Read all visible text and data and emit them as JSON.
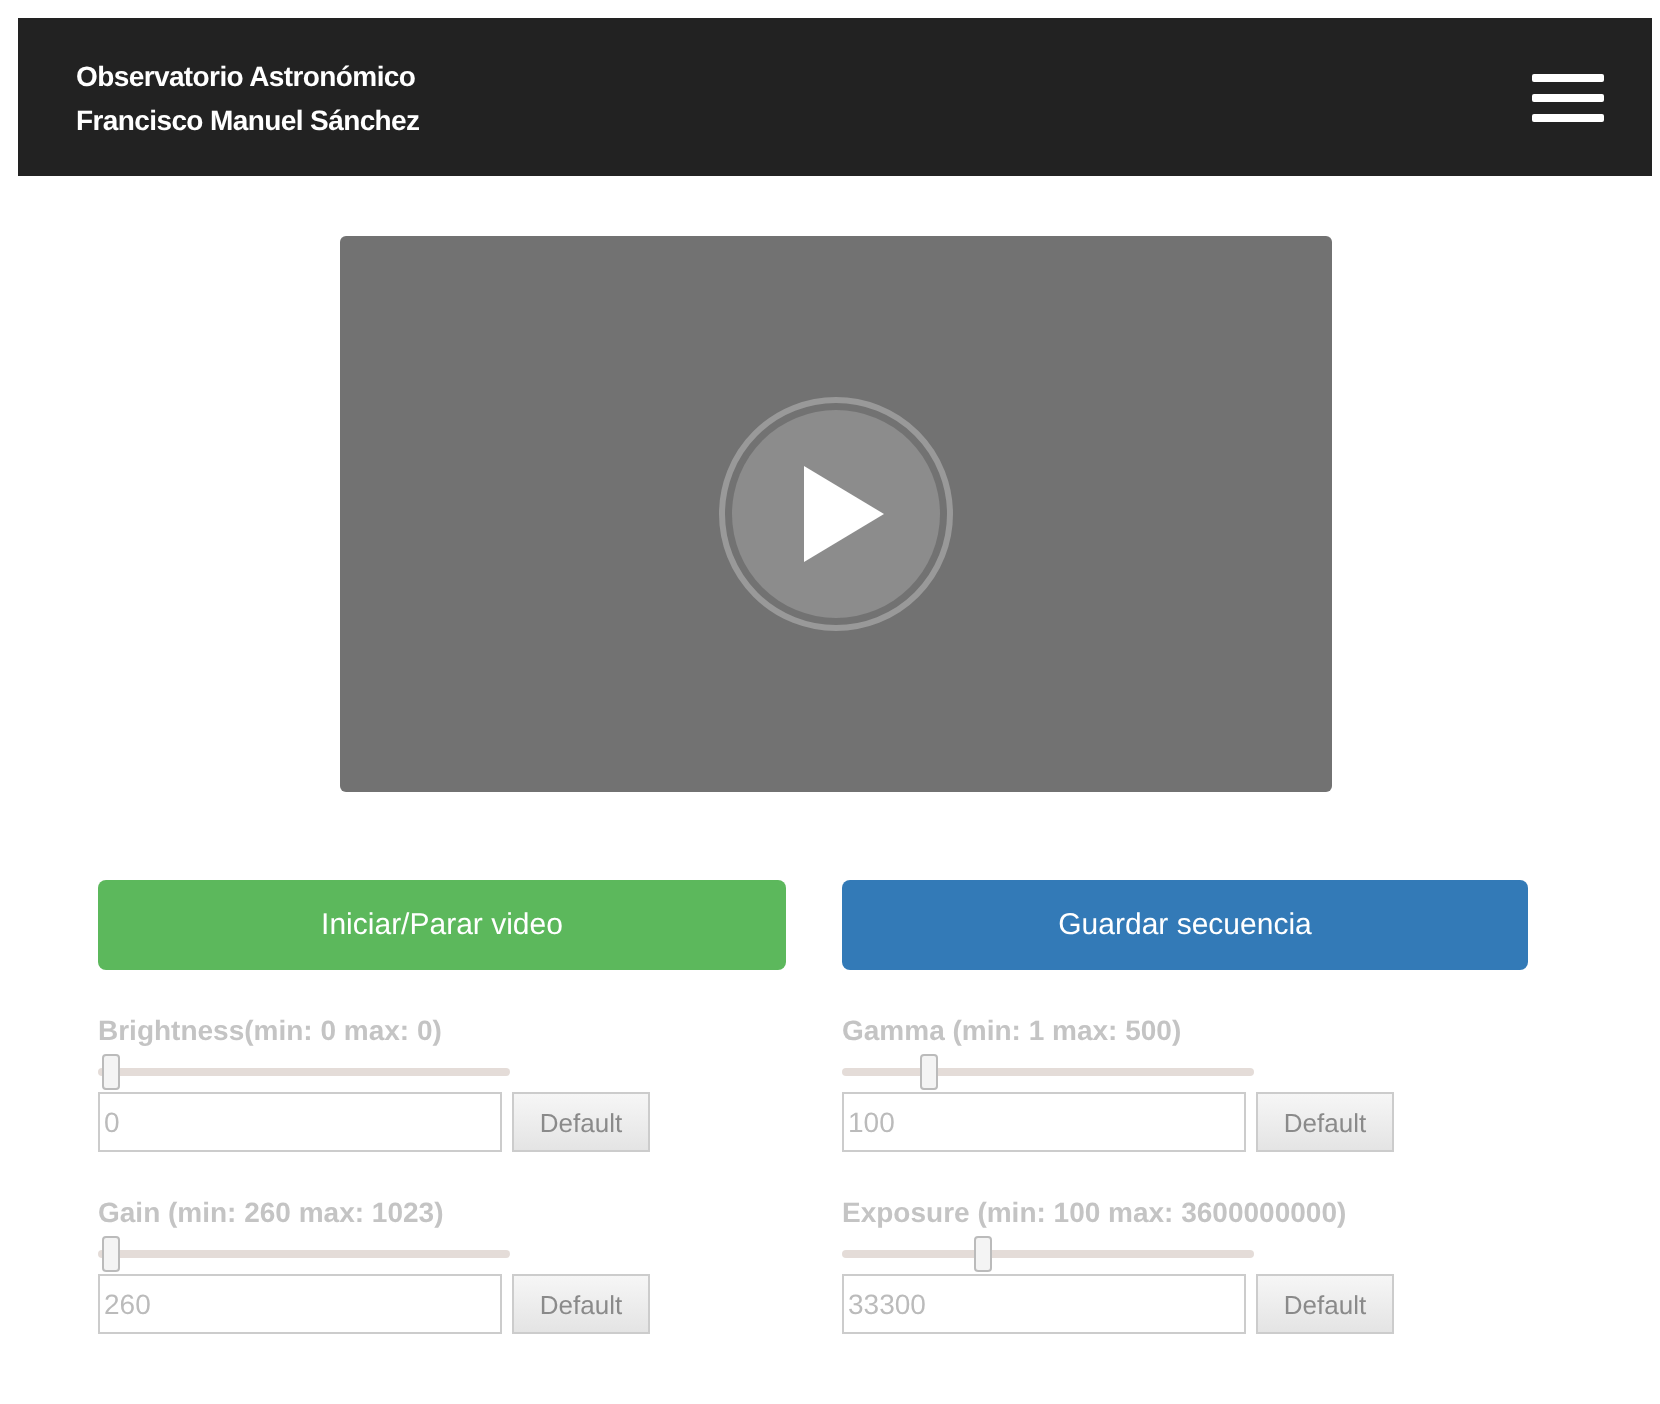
{
  "header": {
    "title_lines": [
      "Observatorio Astronómico",
      "Francisco Manuel Sánchez"
    ]
  },
  "actions": [
    {
      "label": "Iniciar/Parar video",
      "color": "#5cb85c"
    },
    {
      "label": "Guardar secuencia",
      "color": "#337ab7"
    }
  ],
  "controls": [
    {
      "label": "Brightness(min: 0 max: 0)",
      "level": 0.03,
      "value": "0",
      "button": "Default",
      "disabled": true
    },
    {
      "label": "Gamma (min: 1 max: 500)",
      "level": 0.21,
      "value": "100",
      "button": "Default",
      "disabled": true
    },
    {
      "label": "Gain (min: 260 max: 1023)",
      "level": 0.03,
      "value": "260",
      "button": "Default",
      "disabled": true
    },
    {
      "label": "Exposure (min: 100 max: 3600000000)",
      "level": 0.34,
      "value": "33300",
      "button": "Default",
      "disabled": true
    }
  ]
}
